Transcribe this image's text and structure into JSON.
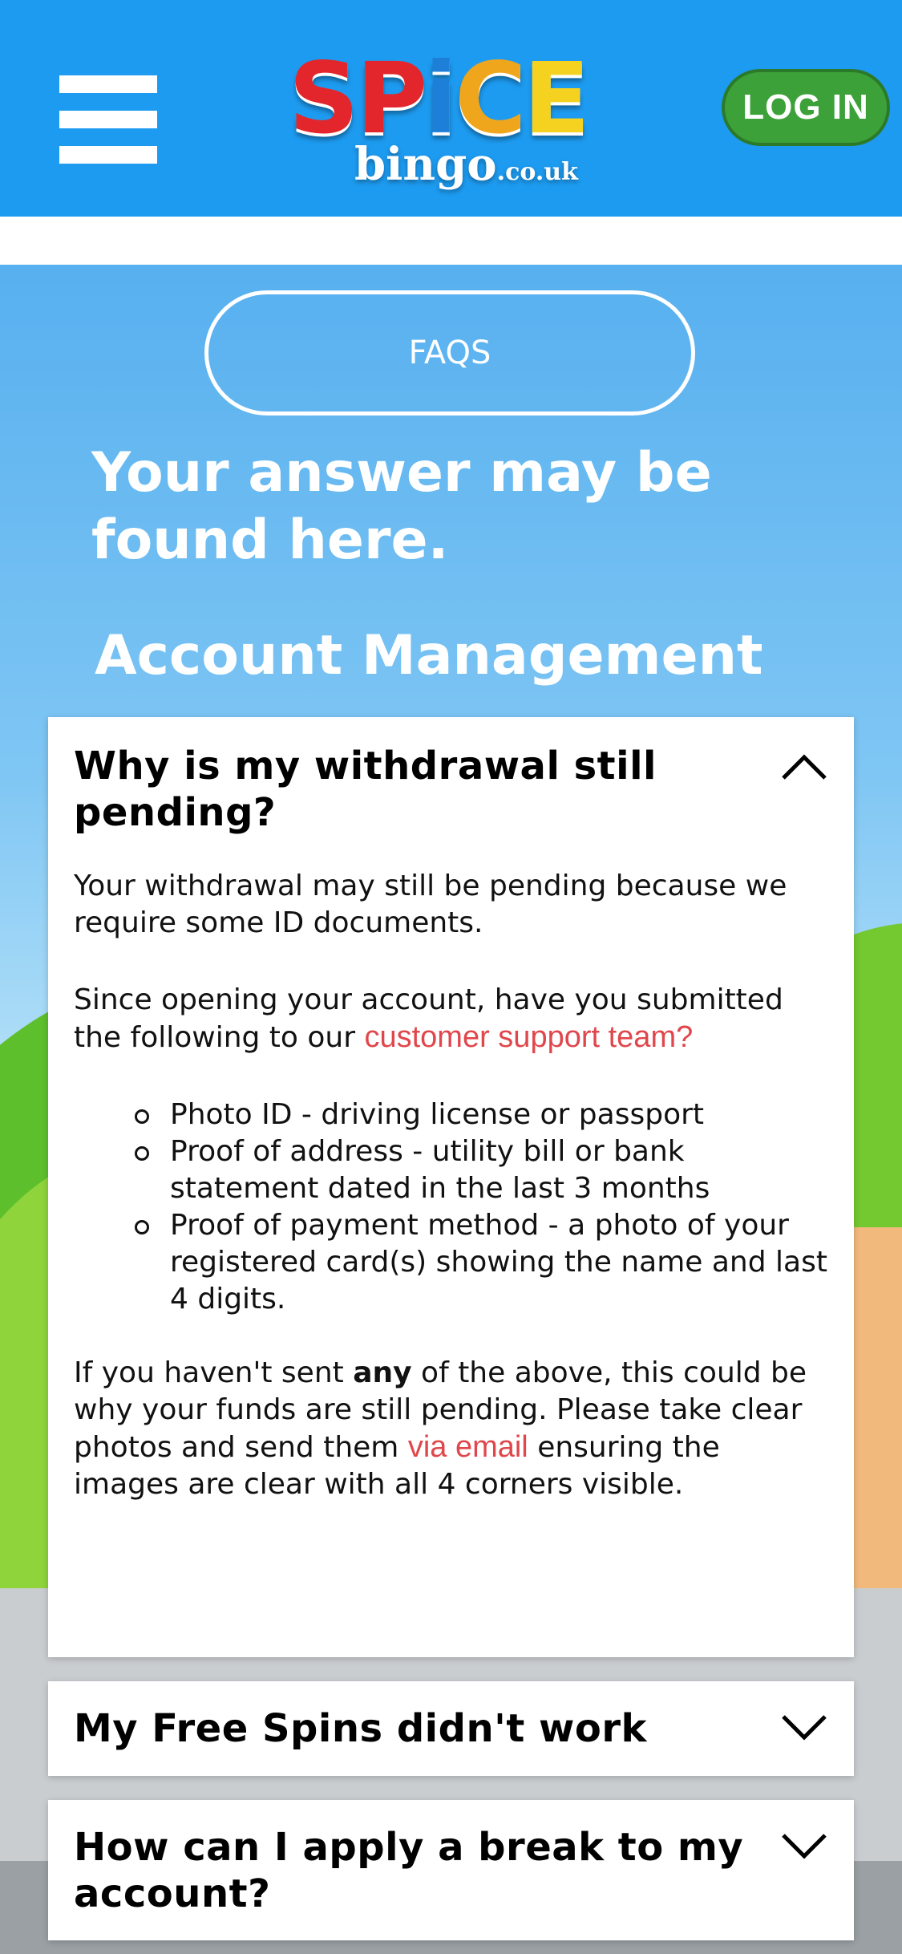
{
  "header": {
    "logo_main": "SPiCE",
    "logo_sub": "bingo",
    "logo_domain": ".co.uk",
    "login_label": "LOG IN"
  },
  "hero": {
    "faq_pill": "FAQS",
    "headline": "Your answer may be found here.",
    "section_title": "Account Management"
  },
  "faqs": [
    {
      "question": "Why is my withdrawal still pending?",
      "expanded": true,
      "p1": "Your withdrawal may still be pending because we require some ID documents.",
      "p2_text": "Since opening your account, have you submitted the following to our ",
      "p2_link": "customer support team?",
      "list": [
        "Photo ID - driving license or passport",
        "Proof of address - utility bill or bank statement dated in the last 3 months",
        "Proof of payment method - a photo of your registered card(s) showing the name and last 4 digits."
      ],
      "p3_a": "If you haven't sent ",
      "p3_bold": "any",
      "p3_b": " of the above, this could be why your funds are still pending. Please take clear photos and send them ",
      "p3_link": "via email",
      "p3_c": " ensuring the images are clear with all 4 corners visible."
    },
    {
      "question": "My Free Spins didn't work",
      "expanded": false
    },
    {
      "question": "How can I apply a break to my account?",
      "expanded": false
    }
  ],
  "colors": {
    "header_bg": "#1d9bf0",
    "login_bg": "#3da13a",
    "link": "#e0474c"
  },
  "icons": {
    "menu": "hamburger-icon",
    "expanded": "chevron-up-icon",
    "collapsed": "chevron-down-icon"
  }
}
